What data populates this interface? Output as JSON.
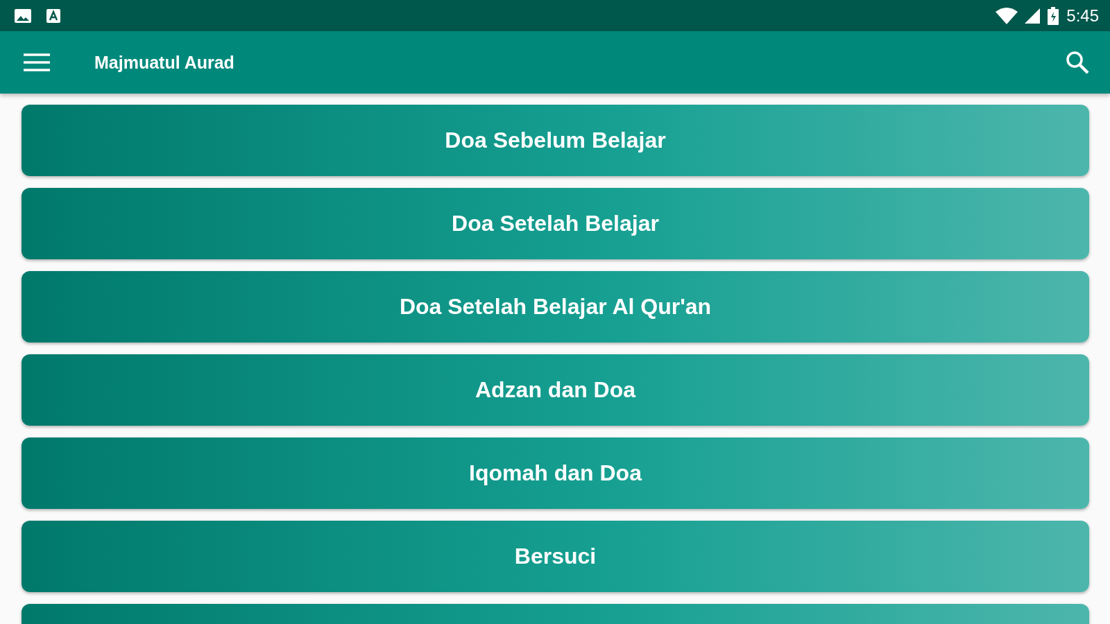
{
  "status_bar": {
    "time": "5:45"
  },
  "app_bar": {
    "title": "Majmuatul Aurad"
  },
  "items": [
    {
      "label": "Doa Sebelum Belajar"
    },
    {
      "label": "Doa Setelah Belajar"
    },
    {
      "label": "Doa Setelah Belajar Al Qur'an"
    },
    {
      "label": "Adzan dan Doa"
    },
    {
      "label": "Iqomah dan Doa"
    },
    {
      "label": "Bersuci"
    }
  ]
}
